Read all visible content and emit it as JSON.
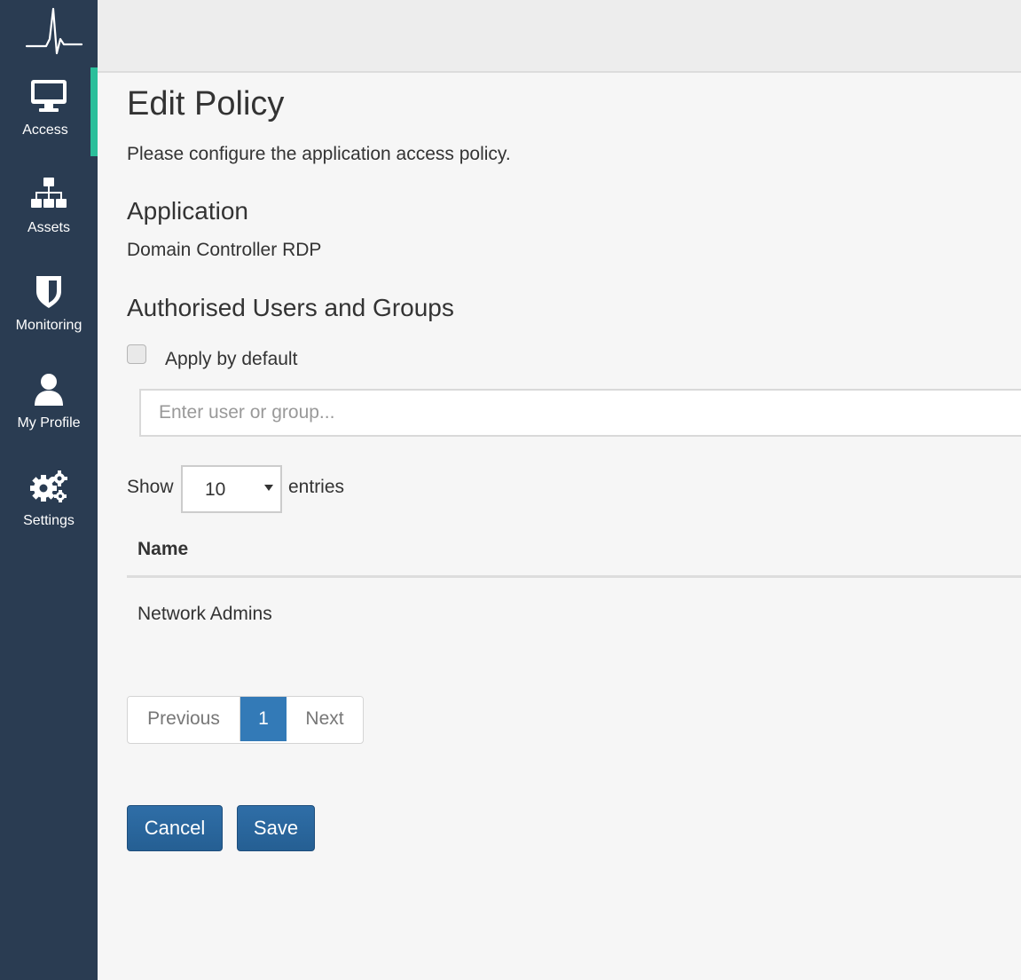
{
  "colors": {
    "sidebar_bg": "#2a3c52",
    "active_accent": "#2bbf9b",
    "primary_button": "#2f6ea7",
    "pagination_active": "#337ab7",
    "page_bg": "#f6f6f6"
  },
  "sidebar": {
    "logo_icon": "heartbeat-icon",
    "items": [
      {
        "label": "Access",
        "icon": "monitor-icon",
        "active": true
      },
      {
        "label": "Assets",
        "icon": "sitemap-icon",
        "active": false
      },
      {
        "label": "Monitoring",
        "icon": "shield-icon",
        "active": false
      },
      {
        "label": "My Profile",
        "icon": "user-icon",
        "active": false
      },
      {
        "label": "Settings",
        "icon": "gears-icon",
        "active": false
      }
    ]
  },
  "page": {
    "title": "Edit Policy",
    "description": "Please configure the application access policy."
  },
  "application": {
    "heading": "Application",
    "name": "Domain Controller RDP"
  },
  "users": {
    "heading": "Authorised Users and Groups",
    "apply_default_label": "Apply by default",
    "apply_default_checked": false,
    "input_placeholder": "Enter user or group...",
    "input_value": ""
  },
  "table": {
    "show_label": "Show",
    "entries_value": "10",
    "entries_label": "entries",
    "columns": [
      "Name"
    ],
    "rows": [
      [
        "Network Admins"
      ]
    ]
  },
  "pagination": {
    "previous_label": "Previous",
    "current_page": "1",
    "next_label": "Next"
  },
  "actions": {
    "cancel_label": "Cancel",
    "save_label": "Save"
  }
}
